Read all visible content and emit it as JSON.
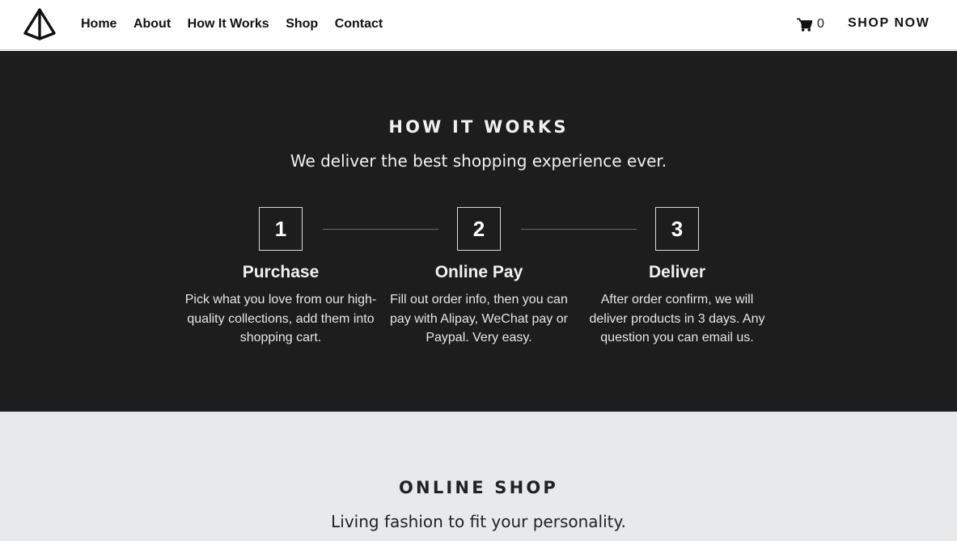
{
  "nav": {
    "logo_icon": "pyramid-logo-icon",
    "links": [
      "Home",
      "About",
      "How It Works",
      "Shop",
      "Contact"
    ],
    "cart_icon": "shopping-cart-icon",
    "cart_count": "0",
    "shop_now": "SHOP NOW"
  },
  "how_it_works": {
    "title": "HOW IT WORKS",
    "subtitle": "We deliver the best shopping experience ever.",
    "steps": [
      {
        "number": "1",
        "title": "Purchase",
        "description": "Pick what you love from our high-quality collections, add them into shopping cart."
      },
      {
        "number": "2",
        "title": "Online Pay",
        "description": "Fill out order info, then you can pay with Alipay, WeChat pay or Paypal. Very easy."
      },
      {
        "number": "3",
        "title": "Deliver",
        "description": "After order confirm, we will deliver products in 3 days. Any question you can email us."
      }
    ]
  },
  "online_shop": {
    "title": "ONLINE SHOP",
    "subtitle": "Living fashion to fit your personality."
  },
  "colors": {
    "dark_section": "#1d1d1d",
    "light_section": "#e8e9eb",
    "nav_background": "#ffffff"
  }
}
